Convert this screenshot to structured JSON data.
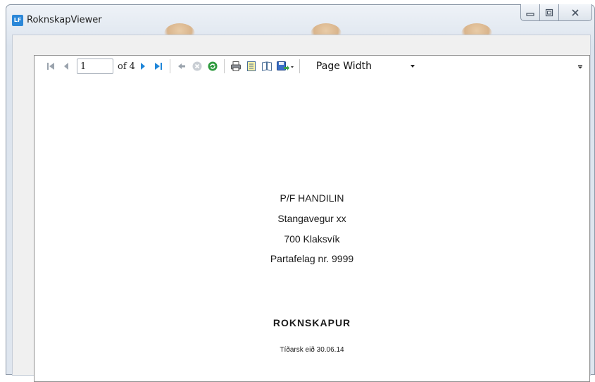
{
  "window": {
    "icon_text": "LF",
    "title": "RoknskapViewer"
  },
  "toolbar": {
    "page_value": "1",
    "of_label": "of",
    "total_pages": "4",
    "zoom": "Page Width",
    "icons": [
      "first-page-icon",
      "previous-page-icon",
      "next-page-icon",
      "last-page-icon",
      "back-icon",
      "stop-icon",
      "refresh-icon",
      "print-icon",
      "print-layout-icon",
      "page-setup-icon",
      "export-icon",
      "chevron-down-icon",
      "overflow-icon"
    ]
  },
  "report": {
    "company": "P/F HANDILIN",
    "street": "Stangavegur xx",
    "city": "700 Klaksvík",
    "registration": "Partafelag nr. 9999",
    "heading": "ROKNSKAPUR",
    "period": "Tíðarsk eið 30.06.14"
  },
  "colors": {
    "accent_blue": "#2b87d8",
    "nav_arrow": "#1f86d9",
    "disabled_gray": "#9aa3ad"
  }
}
